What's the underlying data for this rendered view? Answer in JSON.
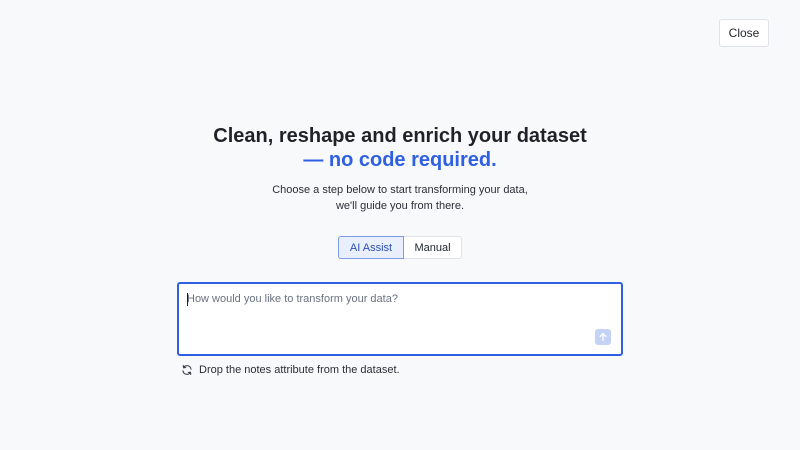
{
  "header": {
    "close_label": "Close"
  },
  "hero": {
    "title_line1": "Clean, reshape and enrich your dataset",
    "title_line2": "— no code required.",
    "subtitle_line1": "Choose a step below to start transforming your data,",
    "subtitle_line2": "we'll guide you from there."
  },
  "mode_toggle": {
    "options": [
      {
        "label": "AI Assist",
        "selected": true
      },
      {
        "label": "Manual",
        "selected": false
      }
    ]
  },
  "prompt": {
    "placeholder": "How would you like to transform your data?",
    "value": "",
    "send_icon": "arrow-up-icon"
  },
  "suggestion": {
    "icon": "refresh-icon",
    "text": "Drop the notes attribute from the dataset."
  },
  "colors": {
    "accent": "#2f5fe3",
    "background": "#f8f9fb",
    "send_button": "#c4d3f5"
  }
}
